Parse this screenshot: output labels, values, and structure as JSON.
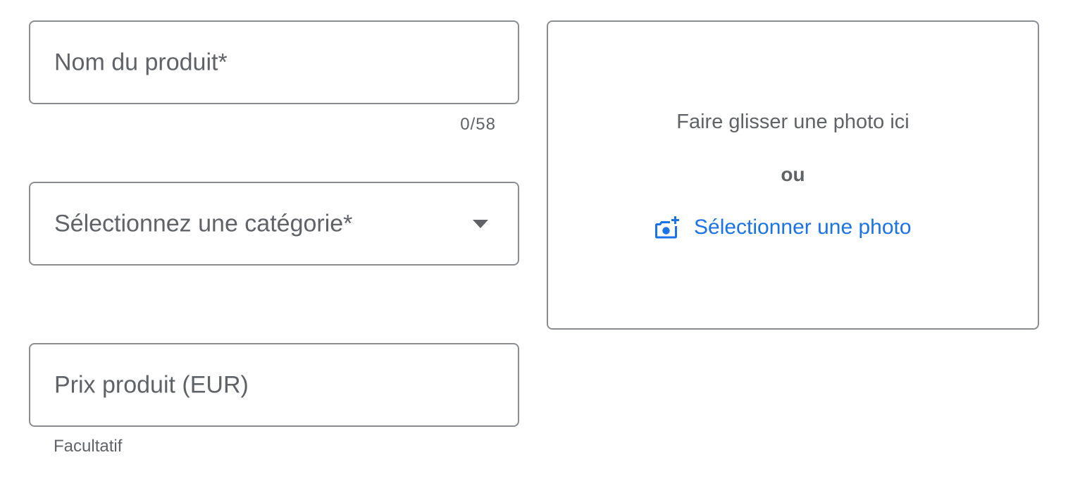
{
  "product_name": {
    "label": "Nom du produit*",
    "value": "",
    "counter": "0/58"
  },
  "category": {
    "label": "Sélectionnez une catégorie*",
    "selected": ""
  },
  "price": {
    "label": "Prix produit (EUR)",
    "value": "",
    "hint": "Facultatif"
  },
  "photo_upload": {
    "drag_text": "Faire glisser une photo ici",
    "or_text": "ou",
    "select_label": "Sélectionner une photo",
    "icon": "add-photo-icon"
  },
  "colors": {
    "link": "#1a73e8",
    "text": "#5f6368",
    "border": "#8a8d91"
  }
}
